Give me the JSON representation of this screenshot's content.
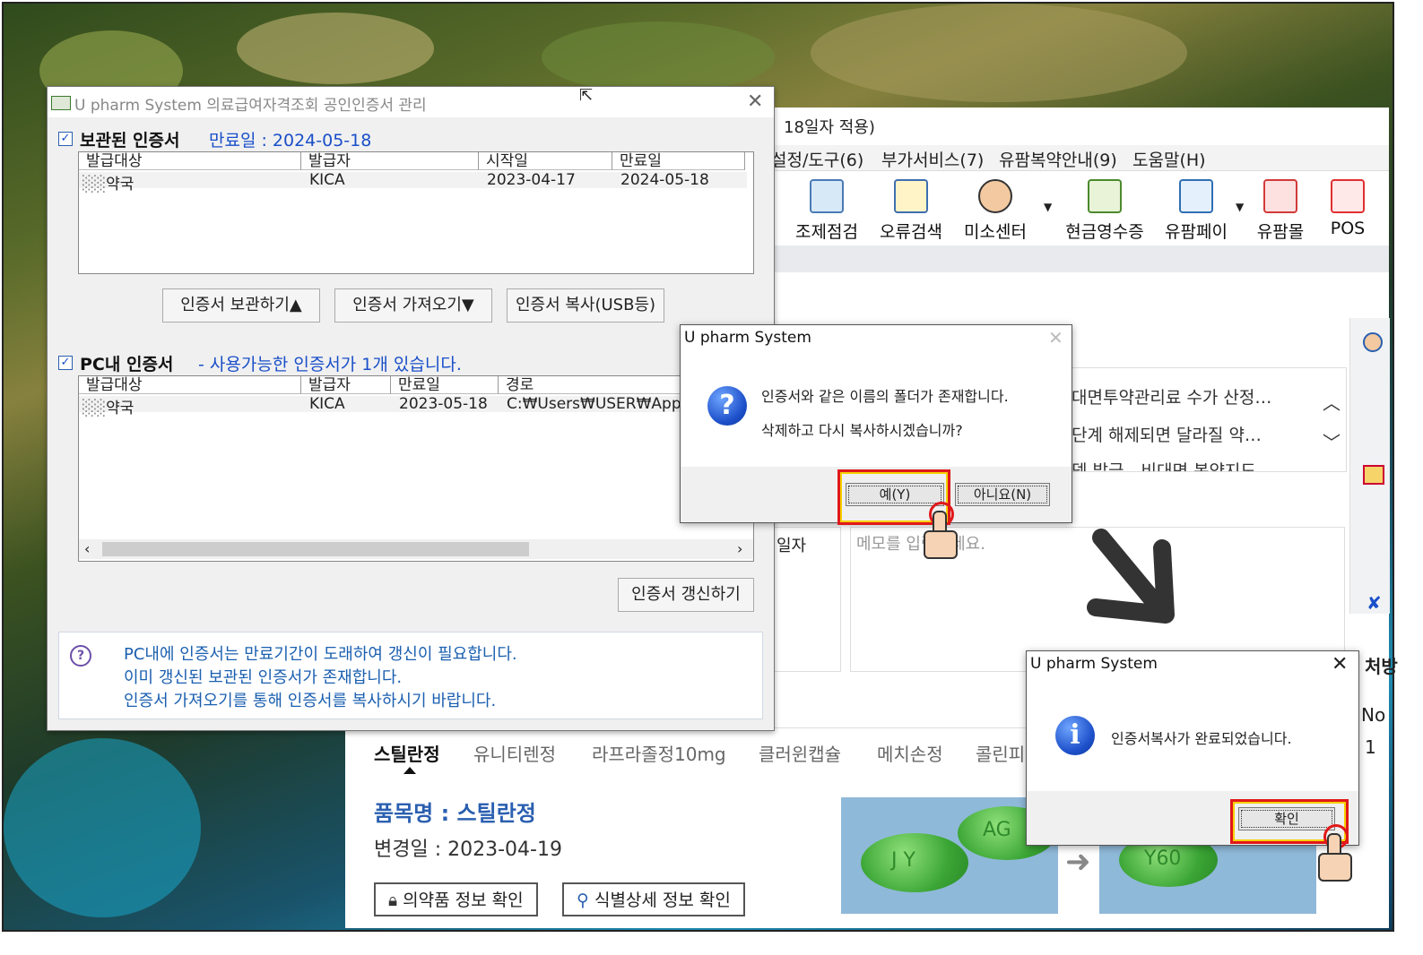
{
  "main_app": {
    "title_fragment": "18일자 적용)",
    "menu": [
      "설정/도구(6)",
      "부가서비스(7)",
      "유팜복약안내(9)",
      "도움말(H)"
    ],
    "tools": [
      "조제점검",
      "오류검색",
      "미소센터",
      "현금영수증",
      "유팜페이",
      "유팜몰",
      "POS"
    ],
    "notices": [
      "대면투약관리료 수가 산정…",
      "단계 해제되면 달라질 약…",
      "뎀 발급…비대면 복약지도…"
    ],
    "date_label": "일자",
    "memo_placeholder": "메모를 입력하세요.",
    "tabs": [
      "스틸란정",
      "유니티렌정",
      "라프라졸정10mg",
      "클러윈캡슐",
      "메치손정",
      "콜린피"
    ],
    "product_name": "품목명 : 스틸란정",
    "changed_date": "변경일 : 2023-04-19",
    "btn_drug_info": "의약품 정보 확인",
    "btn_id_info": "식별상세 정보 확인",
    "right_header": "처방",
    "no_label": "No",
    "no_value": "1",
    "pill_marks_1": [
      "J Y",
      "AG"
    ],
    "pill_marks_2": [
      "Y60"
    ]
  },
  "cert_window": {
    "title": "U pharm System 의료급여자격조회 공인인증서 관리",
    "stored_section": {
      "title": "보관된 인증서",
      "expiry": "만료일 : 2024-05-18",
      "columns": [
        "발급대상",
        "발급자",
        "시작일",
        "만료일"
      ],
      "rows": [
        [
          "약국",
          "KICA",
          "2023-04-17",
          "2024-05-18"
        ]
      ]
    },
    "buttons": [
      "인증서 보관하기▲",
      "인증서 가져오기▼",
      "인증서 복사(USB등)"
    ],
    "pc_section": {
      "title": "PC내 인증서",
      "subtitle": "- 사용가능한 인증서가 1개 있습니다.",
      "columns": [
        "발급대상",
        "발급자",
        "만료일",
        "경로"
      ],
      "rows": [
        [
          "약국",
          "KICA",
          "2023-05-18",
          "C:₩Users₩USER₩App"
        ]
      ]
    },
    "renew_button": "인증서 갱신하기",
    "info_lines": [
      "PC내에 인증서는 만료기간이 도래하여 갱신이 필요합니다.",
      "이미 갱신된 보관된 인증서가 존재합니다.",
      "인증서 가져오기를 통해 인증서를 복사하시기 바랍니다."
    ]
  },
  "confirm_dialog": {
    "title": "U pharm System",
    "line1": "인증서와 같은 이름의 폴더가 존재합니다.",
    "line2": "삭제하고 다시 복사하시겠습니까?",
    "yes": "예(Y)",
    "no": "아니요(N)"
  },
  "done_dialog": {
    "title": "U pharm System",
    "message": "인증서복사가 완료되었습니다.",
    "ok": "확인"
  }
}
